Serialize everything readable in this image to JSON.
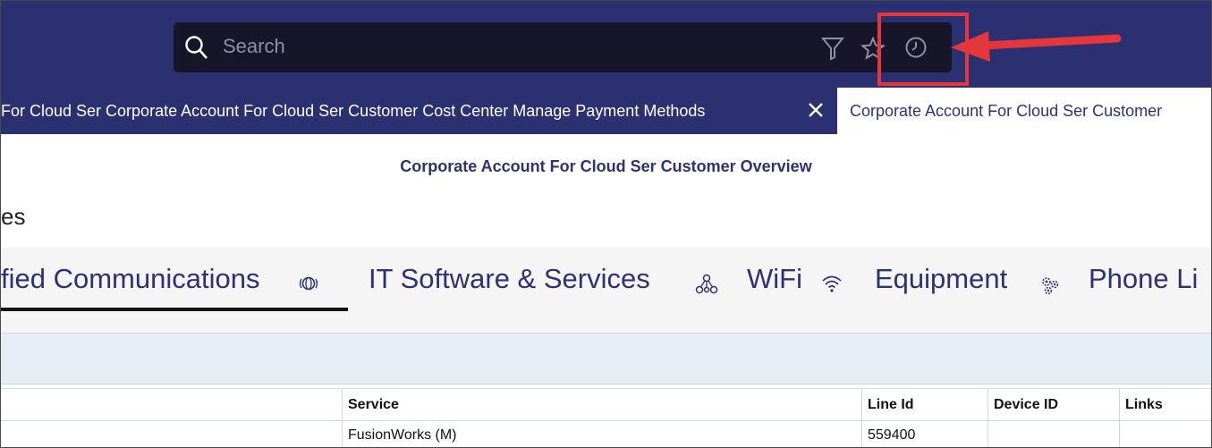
{
  "search": {
    "placeholder": "Search"
  },
  "icons": {
    "search": "search-icon",
    "filter": "filter-icon",
    "favorite": "star-icon",
    "history": "clock-icon",
    "close": "close-icon"
  },
  "tabs": [
    {
      "label": "For Cloud Ser Corporate Account For Cloud Ser Customer Cost Center Manage Payment Methods"
    },
    {
      "label": "Corporate Account For Cloud Ser Customer"
    }
  ],
  "page": {
    "title": "Corporate Account For Cloud Ser Customer Overview",
    "breadcrumb_fragment": "es"
  },
  "categories": [
    {
      "label": "fied Communications",
      "icon": "globe-icon"
    },
    {
      "label": "IT Software & Services",
      "icon": "network-icon"
    },
    {
      "label": "WiFi",
      "icon": "wifi-icon"
    },
    {
      "label": "Equipment",
      "icon": "gears-icon"
    },
    {
      "label": "Phone Li"
    }
  ],
  "table": {
    "headers": [
      "Service",
      "Line Id",
      "Device ID",
      "Links"
    ],
    "rows": [
      [
        "FusionWorks (M)",
        "559400",
        "",
        ""
      ]
    ]
  },
  "colors": {
    "topbar": "#2b3070",
    "search_bg": "#16152a",
    "accent_text": "#2e3274",
    "annotation": "#e4373b",
    "filter_strip": "#e6edf5"
  }
}
